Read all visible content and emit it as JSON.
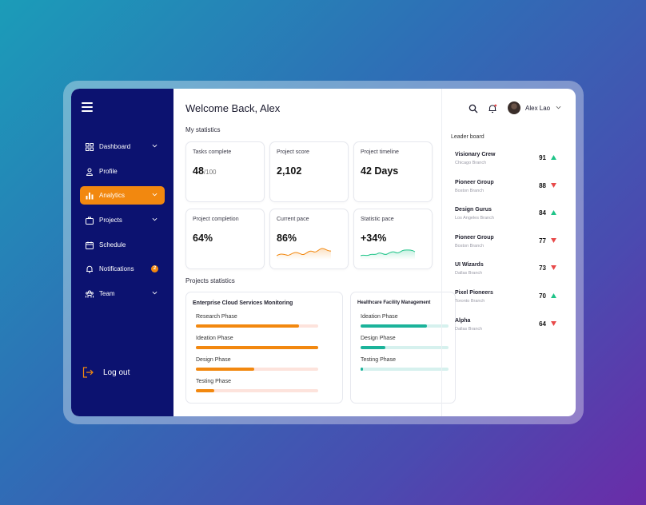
{
  "colors": {
    "sidebar": "#0c1270",
    "accent": "#f2880f",
    "teal": "#1bb39a",
    "up": "#1fc488",
    "down": "#e84a4a"
  },
  "sidebar": {
    "items": [
      {
        "label": "Dashboard",
        "icon": "dashboard-icon",
        "chevron": true
      },
      {
        "label": "Profile",
        "icon": "user-icon",
        "chevron": false
      },
      {
        "label": "Analytics",
        "icon": "bar-chart-icon",
        "chevron": true,
        "active": true
      },
      {
        "label": "Projects",
        "icon": "briefcase-icon",
        "chevron": true
      },
      {
        "label": "Schedule",
        "icon": "calendar-icon",
        "chevron": false
      },
      {
        "label": "Notifications",
        "icon": "bell-icon",
        "badge": "2"
      },
      {
        "label": "Team",
        "icon": "team-icon",
        "chevron": true
      }
    ],
    "logout_label": "Log out"
  },
  "header": {
    "welcome": "Welcome Back, Alex",
    "user_name": "Alex Lao"
  },
  "my_statistics": {
    "label": "My statistics",
    "cards": [
      {
        "title": "Tasks complete",
        "value": "48",
        "sub": "/100"
      },
      {
        "title": "Project score",
        "value": "2,102"
      },
      {
        "title": "Project timeline",
        "value": "42 Days"
      },
      {
        "title": "Project completion",
        "value": "64%"
      },
      {
        "title": "Current pace",
        "value": "86%"
      },
      {
        "title": "Statistic pace",
        "value": "+34%"
      }
    ]
  },
  "projects_statistics": {
    "label": "Projects statistics",
    "projects": [
      {
        "title": "Enterprise Cloud Services Monitoring",
        "phases": [
          {
            "label": "Research Phase",
            "progress": 0.84
          },
          {
            "label": "Ideation Phase",
            "progress": 1.0
          },
          {
            "label": "Design Phase",
            "progress": 0.48
          },
          {
            "label": "Testing Phase",
            "progress": 0.15
          }
        ]
      },
      {
        "title": "Healthcare Facility Management",
        "phases": [
          {
            "label": "Ideation Phase",
            "progress": 0.75
          },
          {
            "label": "Design Phase",
            "progress": 0.28
          },
          {
            "label": "Testing Phase",
            "progress": 0.02
          }
        ]
      }
    ]
  },
  "leaderboard": {
    "title": "Leader board",
    "rows": [
      {
        "name": "Visionary Crew",
        "branch": "Chicago Branch",
        "score": "91",
        "trend": "up"
      },
      {
        "name": "Pioneer Group",
        "branch": "Boston Branch",
        "score": "88",
        "trend": "down"
      },
      {
        "name": "Design Gurus",
        "branch": "Los Angeles Branch",
        "score": "84",
        "trend": "up"
      },
      {
        "name": "Pioneer Group",
        "branch": "Boston Branch",
        "score": "77",
        "trend": "down"
      },
      {
        "name": "UI Wizards",
        "branch": "Dallas Branch",
        "score": "73",
        "trend": "down"
      },
      {
        "name": "Pixel Pioneers",
        "branch": "Toronto Branch",
        "score": "70",
        "trend": "up"
      },
      {
        "name": "Alpha",
        "branch": "Dallas Branch",
        "score": "64",
        "trend": "down"
      }
    ]
  }
}
